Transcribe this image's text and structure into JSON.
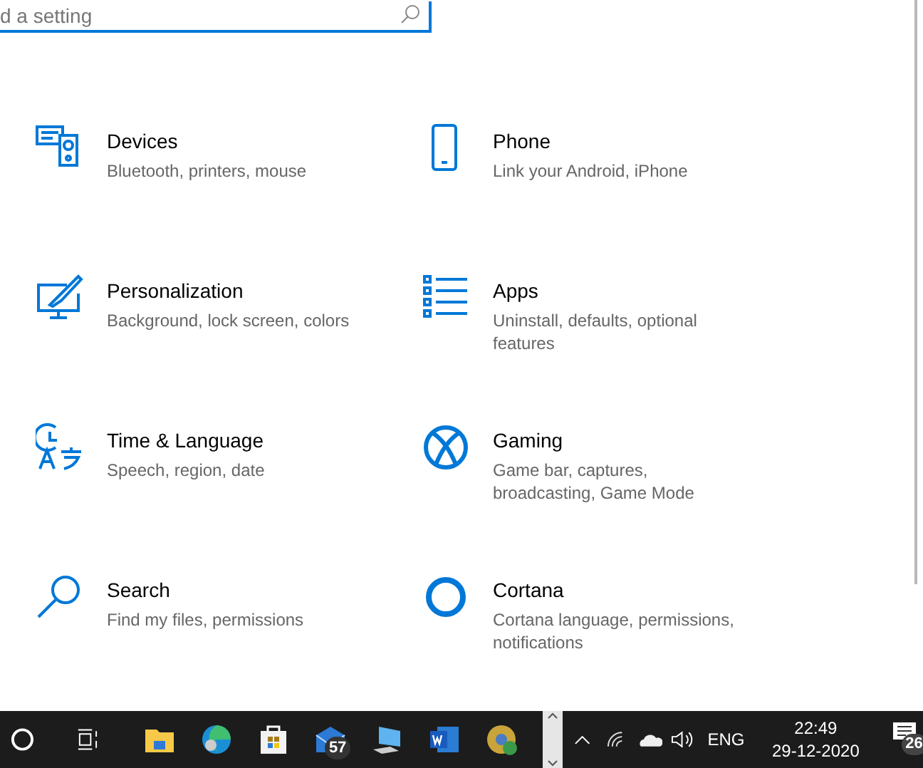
{
  "search": {
    "placeholder": "d a setting"
  },
  "categories": [
    {
      "kind": "devices",
      "title": "Devices",
      "description": "Bluetooth, printers, mouse"
    },
    {
      "kind": "phone",
      "title": "Phone",
      "description": "Link your Android, iPhone"
    },
    {
      "kind": "personalization",
      "title": "Personalization",
      "description": "Background, lock screen, colors"
    },
    {
      "kind": "apps",
      "title": "Apps",
      "description": "Uninstall, defaults, optional features"
    },
    {
      "kind": "time",
      "title": "Time & Language",
      "description": "Speech, region, date"
    },
    {
      "kind": "gaming",
      "title": "Gaming",
      "description": "Game bar, captures, broadcasting, Game Mode"
    },
    {
      "kind": "search",
      "title": "Search",
      "description": "Find my files, permissions"
    },
    {
      "kind": "cortana",
      "title": "Cortana",
      "description": "Cortana language, permissions, notifications"
    }
  ],
  "taskbar": {
    "apps": [
      {
        "kind": "explorer"
      },
      {
        "kind": "edge"
      },
      {
        "kind": "store"
      },
      {
        "kind": "mail",
        "badge": "57"
      },
      {
        "kind": "pc"
      },
      {
        "kind": "word"
      },
      {
        "kind": "chrome"
      }
    ],
    "language": "ENG",
    "time": "22:49",
    "date": "29-12-2020",
    "notifications_badge": "26"
  }
}
